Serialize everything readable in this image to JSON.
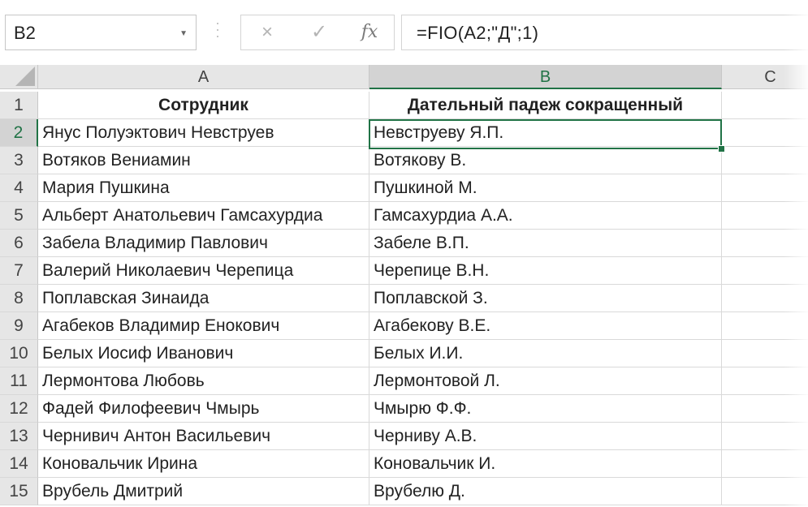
{
  "name_box": {
    "value": "B2",
    "dropdown_icon": "triangle-down"
  },
  "formula_bar": {
    "cancel_icon": "×",
    "enter_icon": "✓",
    "fx_label": "fx",
    "formula": "=FIO(A2;\"Д\";1)"
  },
  "columns": [
    "A",
    "B",
    "C"
  ],
  "rows": [
    {
      "num": "1",
      "a": "Сотрудник",
      "b": "Дательный падеж сокращенный"
    },
    {
      "num": "2",
      "a": "Янус Полуэктович Невструев",
      "b": "Невструеву Я.П."
    },
    {
      "num": "3",
      "a": "Вотяков Вениамин",
      "b": "Вотякову В."
    },
    {
      "num": "4",
      "a": "Мария Пушкина",
      "b": "Пушкиной М."
    },
    {
      "num": "5",
      "a": "Альберт Анатольевич Гамсахурдиа",
      "b": "Гамсахурдиа А.А."
    },
    {
      "num": "6",
      "a": "Забела Владимир Павлович",
      "b": "Забеле В.П."
    },
    {
      "num": "7",
      "a": "Валерий Николаевич Черепица",
      "b": "Черепице В.Н."
    },
    {
      "num": "8",
      "a": "Поплавская Зинаида",
      "b": "Поплавской З."
    },
    {
      "num": "9",
      "a": "Агабеков Владимир Енокович",
      "b": "Агабекову В.Е."
    },
    {
      "num": "10",
      "a": "Белых Иосиф Иванович",
      "b": "Белых И.И."
    },
    {
      "num": "11",
      "a": "Лермонтова Любовь",
      "b": "Лермонтовой Л."
    },
    {
      "num": "12",
      "a": "Фадей Филофеевич Чмырь",
      "b": "Чмырю Ф.Ф."
    },
    {
      "num": "13",
      "a": "Чернивич Антон Васильевич",
      "b": "Черниву А.В."
    },
    {
      "num": "14",
      "a": "Коновальчик Ирина",
      "b": "Коновальчик И."
    },
    {
      "num": "15",
      "a": "Врубель Дмитрий",
      "b": "Врубелю Д."
    }
  ],
  "selected_cell": "B2",
  "accent_color": "#217346"
}
